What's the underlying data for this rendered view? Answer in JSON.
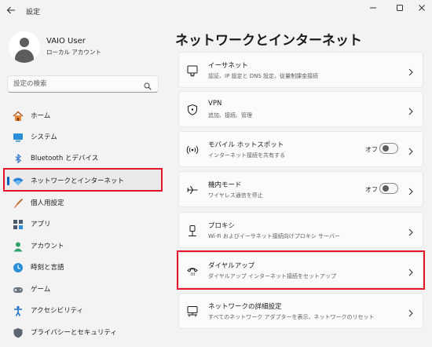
{
  "window": {
    "title": "設定",
    "back_icon": "back-arrow-icon",
    "minimize_icon": "minimize-icon",
    "maximize_icon": "maximize-icon",
    "close_icon": "close-icon"
  },
  "user": {
    "name": "VAIO User",
    "account_type": "ローカル アカウント"
  },
  "search": {
    "placeholder": "設定の検索"
  },
  "sidebar": {
    "items": [
      {
        "label": "ホーム",
        "icon": "home-icon"
      },
      {
        "label": "システム",
        "icon": "system-icon"
      },
      {
        "label": "Bluetooth とデバイス",
        "icon": "bluetooth-icon"
      },
      {
        "label": "ネットワークとインターネット",
        "icon": "network-icon",
        "active": true
      },
      {
        "label": "個人用設定",
        "icon": "brush-icon"
      },
      {
        "label": "アプリ",
        "icon": "apps-icon"
      },
      {
        "label": "アカウント",
        "icon": "account-icon"
      },
      {
        "label": "時刻と言語",
        "icon": "time-language-icon"
      },
      {
        "label": "ゲーム",
        "icon": "gaming-icon"
      },
      {
        "label": "アクセシビリティ",
        "icon": "accessibility-icon"
      },
      {
        "label": "プライバシーとセキュリティ",
        "icon": "shield-icon"
      }
    ]
  },
  "main": {
    "title": "ネットワークとインターネット",
    "cards": [
      {
        "title": "イーサネット",
        "subtitle": "認証、IP 設定と DNS 設定、従量制課金接続",
        "icon": "ethernet-icon"
      },
      {
        "title": "VPN",
        "subtitle": "追加、接続、管理",
        "icon": "vpn-shield-icon"
      },
      {
        "title": "モバイル ホットスポット",
        "subtitle": "インターネット接続を共有する",
        "icon": "hotspot-icon",
        "toggle": "オフ"
      },
      {
        "title": "機内モード",
        "subtitle": "ワイヤレス通信を停止",
        "icon": "airplane-icon",
        "toggle": "オフ"
      },
      {
        "title": "プロキシ",
        "subtitle": "Wi-Fi およびイーサネット接続向けプロキシ サーバー",
        "icon": "proxy-icon"
      },
      {
        "title": "ダイヤルアップ",
        "subtitle": "ダイヤルアップ インターネット接続をセットアップ",
        "icon": "dialup-icon"
      },
      {
        "title": "ネットワークの詳細設定",
        "subtitle": "すべてのネットワーク アダプターを表示、ネットワークのリセット",
        "icon": "advanced-network-icon"
      }
    ]
  },
  "colors": {
    "accent": "#005fb8",
    "highlight_box": "#e3132a",
    "background": "#f3f3f3",
    "card": "#fbfbfb"
  }
}
